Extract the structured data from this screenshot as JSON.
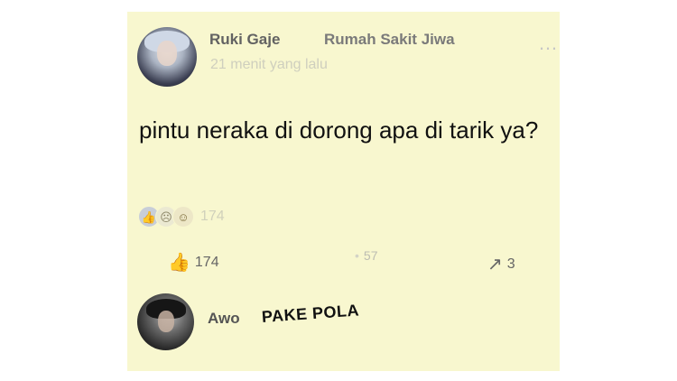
{
  "post": {
    "author": "Ruki Gaje",
    "location": "Rumah Sakit Jiwa",
    "time": "21 menit yang lalu",
    "more_icon": "more-icon",
    "text": "pintu neraka di dorong apa di tarik ya?",
    "reactions": {
      "icons": [
        "like-icon",
        "sad-icon",
        "haha-icon"
      ],
      "count": "174"
    },
    "actions": {
      "like_count": "174",
      "comment_count": "57",
      "share_count": "3"
    }
  },
  "comment": {
    "author": "Awo",
    "text": "PAKE POLA"
  }
}
